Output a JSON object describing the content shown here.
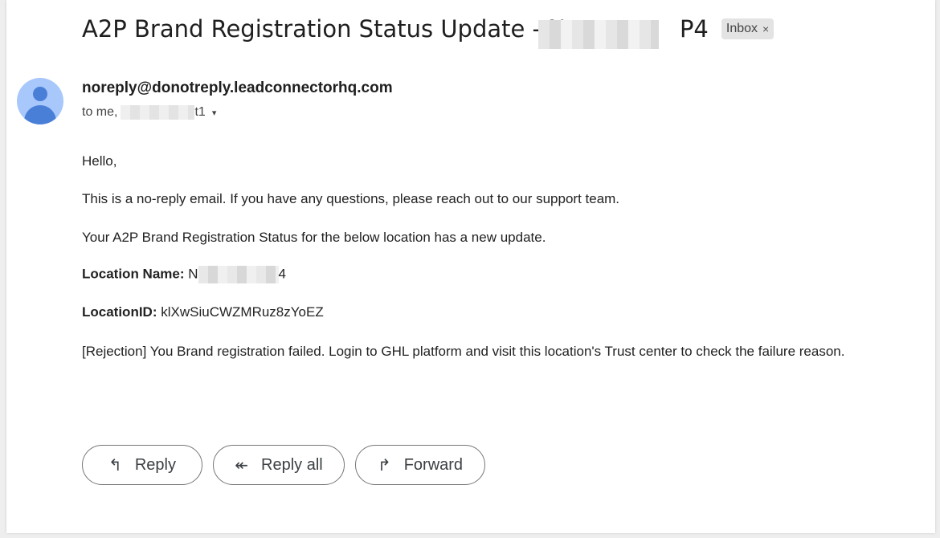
{
  "email": {
    "subject_prefix": "A2P Brand Registration Status Update - N",
    "subject_suffix": "P4",
    "label_badge": "Inbox",
    "label_badge_close": "×",
    "sender": "noreply@donotreply.leadconnectorhq.com",
    "to_prefix": "to me,",
    "to_suffix": "t1",
    "caret": "▾"
  },
  "body": {
    "greeting": "Hello,",
    "line1": "This is a no-reply email. If you have any questions, please reach out to our support team.",
    "line2": "Your A2P Brand Registration Status for the below location has a new update.",
    "location_name_label": "Location Name:",
    "location_name_prefix": "N",
    "location_name_suffix": "4",
    "location_id_label": "LocationID:",
    "location_id_value": "klXwSiuCWZMRuz8zYoEZ",
    "rejection": "[Rejection] You Brand registration failed. Login to GHL platform and visit this location's Trust center to check the failure reason."
  },
  "actions": {
    "reply": "Reply",
    "reply_all": "Reply all",
    "forward": "Forward",
    "reply_icon": "↰",
    "reply_all_icon": "↞",
    "forward_icon": "↱"
  },
  "colors": {
    "avatar_bg": "#a8c7fa",
    "avatar_fg": "#4a7fd8"
  }
}
